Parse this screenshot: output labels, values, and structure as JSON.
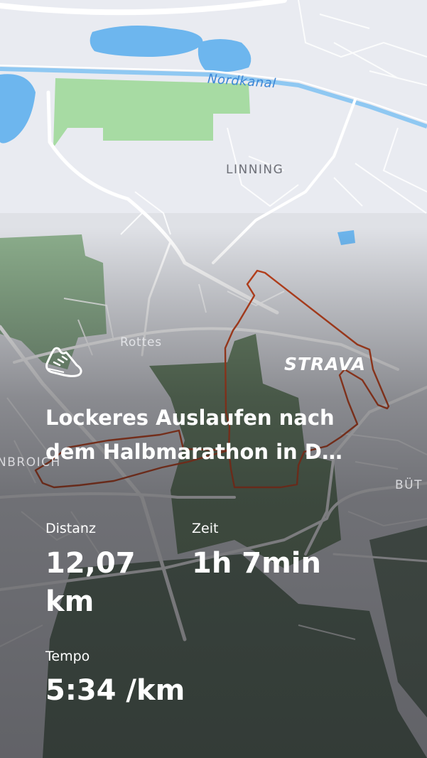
{
  "map": {
    "labels": {
      "canal": "Nordkanal",
      "linning": "LINNING",
      "rottes": "Rottes",
      "nbroich": "NBROICH",
      "bu": "BÜT"
    },
    "colors": {
      "route": "#c7441c",
      "water": "#6db6ee",
      "park": "#a7dba3",
      "forest_dark": "#5c7856",
      "land": "#e9ebf1"
    }
  },
  "brand": "STRAVA",
  "activity": {
    "icon": "running-shoe-icon",
    "title": "Lockeres Auslaufen nach dem Halbmarathon in D…"
  },
  "stats": {
    "distance": {
      "label": "Distanz",
      "value": "12,07 km"
    },
    "time": {
      "label": "Zeit",
      "value": "1h 7min"
    },
    "pace": {
      "label": "Tempo",
      "value": "5:34 /km"
    }
  }
}
